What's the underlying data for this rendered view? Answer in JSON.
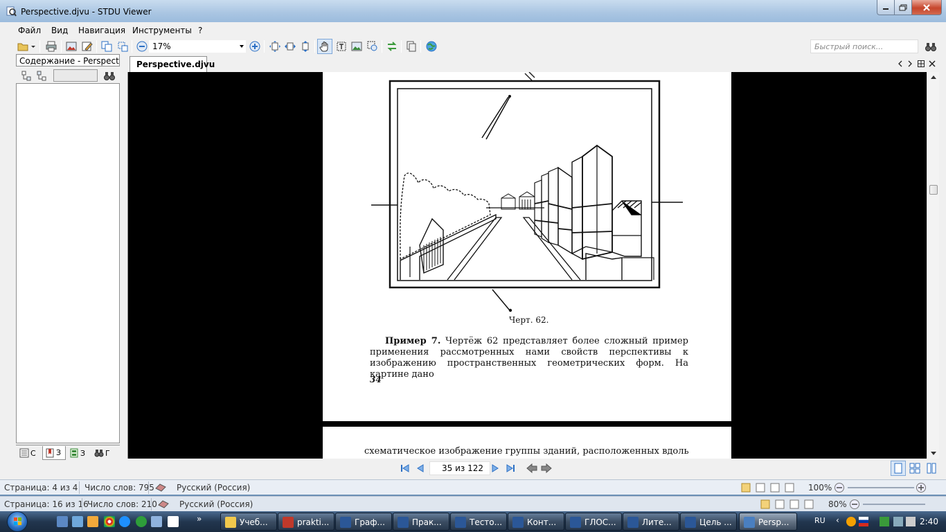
{
  "window": {
    "title": "Perspective.djvu - STDU Viewer"
  },
  "menu": [
    "Файл",
    "Вид",
    "Навигация",
    "Инструменты",
    "?"
  ],
  "toolbar": {
    "zoom_value": "17%",
    "search_placeholder": "Быстрый поиск..."
  },
  "left_panel": {
    "contents_label": "Содержание - Perspective.djvu",
    "tabs": [
      {
        "label": "С",
        "icon": "contents-icon"
      },
      {
        "label": "З",
        "icon": "bookmarks-icon"
      },
      {
        "label": "З",
        "icon": "thumbnails-icon"
      },
      {
        "label": "Г",
        "icon": "search-results-icon"
      }
    ]
  },
  "doc_tab": {
    "label": "Perspective.djvu"
  },
  "page_content": {
    "caption": "Черт. 62.",
    "example_title": "Пример 7.",
    "paragraph": "Чертёж 62 представляет более сложный пример применения рассмотренных нами свойств перспективы к изображению пространственных геометрических форм. На картине дано",
    "page_number": "34",
    "next_page_text": "схематическое изображение группы зданий, расположенных вдоль"
  },
  "pagenav": {
    "page_indicator": "35 из 122"
  },
  "status_bars": [
    {
      "page": "Страница: 4 из 4",
      "words": "Число слов: 795",
      "language": "Русский (Россия)",
      "zoom": "100%"
    },
    {
      "page": "Страница: 16 из 16",
      "words": "Число слов: 210",
      "language": "Русский (Россия)",
      "zoom": "80%"
    }
  ],
  "taskbar": {
    "tasks": [
      {
        "label": "Учеб...",
        "color": "#f2c94c"
      },
      {
        "label": "prakti...",
        "color": "#c0392b"
      },
      {
        "label": "Граф...",
        "color": "#2b5797"
      },
      {
        "label": "Прак...",
        "color": "#2b5797"
      },
      {
        "label": "Тесто...",
        "color": "#2b5797"
      },
      {
        "label": "Конт...",
        "color": "#2b5797"
      },
      {
        "label": "ГЛОС...",
        "color": "#2b5797"
      },
      {
        "label": "Лите...",
        "color": "#2b5797"
      },
      {
        "label": "Цель ...",
        "color": "#2b5797"
      },
      {
        "label": "Persp...",
        "color": "#4a7fc0"
      }
    ],
    "language": "RU",
    "clock": "2:40"
  }
}
